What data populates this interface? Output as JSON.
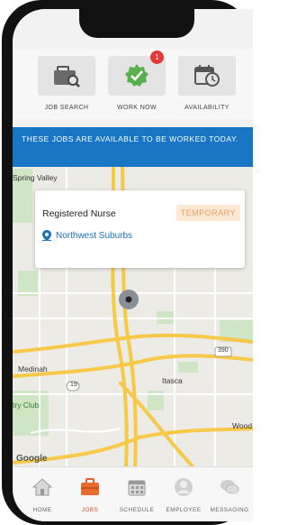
{
  "top_actions": [
    {
      "label": "JOB SEARCH",
      "icon": "briefcase-search-icon"
    },
    {
      "label": "WORK NOW",
      "icon": "check-badge-icon",
      "badge": "1"
    },
    {
      "label": "AVAILABILITY",
      "icon": "calendar-clock-icon"
    }
  ],
  "banner": {
    "text": "THESE JOBS ARE AVAILABLE TO BE WORKED TODAY."
  },
  "map": {
    "labels": {
      "spring_valley": "Spring Valley",
      "medinah": "Medinah",
      "itasca": "Itasca",
      "country_club": "try Club",
      "wood": "Wood",
      "google": "Google",
      "route_19": "19",
      "route_390": "390"
    }
  },
  "job_card": {
    "title": "Registered Nurse",
    "tag": "TEMPORARY",
    "location": "Northwest Suburbs"
  },
  "bottom_nav": [
    {
      "label": "HOME",
      "icon": "home-icon"
    },
    {
      "label": "JOBS",
      "icon": "briefcase-icon",
      "active": true
    },
    {
      "label": "SCHEDULE",
      "icon": "calendar-icon"
    },
    {
      "label": "EMPLOYEE",
      "icon": "user-icon"
    },
    {
      "label": "MESSAGING",
      "icon": "chat-icon"
    }
  ],
  "colors": {
    "accent": "#1976c5",
    "active_tab": "#d9532b",
    "badge": "#e53935",
    "tag_bg": "#fde8d3",
    "tag_text": "#f1a060"
  }
}
